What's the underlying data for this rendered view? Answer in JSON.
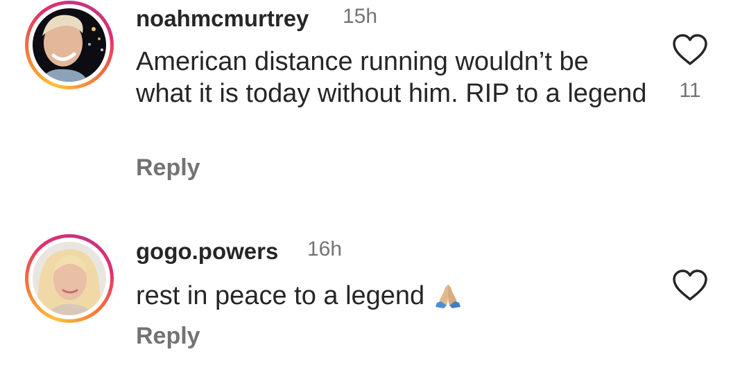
{
  "comments": [
    {
      "username": "noahmcmurtrey",
      "time": "15h",
      "text": "American distance running wouldn’t be what it is today without him. RIP to a legend",
      "reply_label": "Reply",
      "like_count": "11",
      "avatar_icon": "profile-photo-man-smiling-night"
    },
    {
      "username": "gogo.powers",
      "time": "16h",
      "text": "rest in peace to a legend",
      "emoji_icon": "folded-hands-emoji",
      "reply_label": "Reply",
      "avatar_icon": "profile-photo-blonde-woman"
    }
  ],
  "colors": {
    "text": "#262626",
    "secondary_text": "#737373",
    "story_ring_start": "#fdc13a",
    "story_ring_end": "#c13584"
  }
}
